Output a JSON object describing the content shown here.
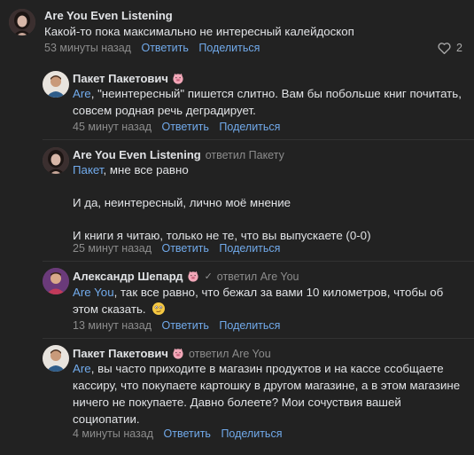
{
  "comments": [
    {
      "author": "Are You Even Listening",
      "text": "Какой-то пока максимально не интересный калейдоскоп",
      "time": "53 минуты назад",
      "reply_label": "Ответить",
      "share_label": "Поделиться",
      "likes": "2"
    },
    {
      "author": "Пакет Пакетович",
      "mention": "Are",
      "text": ", \"неинтересный\" пишется слитно. Вам бы побольше книг почитать, совсем родная речь деградирует.",
      "time": "45 минут назад",
      "reply_label": "Ответить",
      "share_label": "Поделиться"
    },
    {
      "author": "Are You Even Listening",
      "replied_to": "ответил Пакету",
      "mention": "Пакет",
      "text_line1": ", мне все равно",
      "text_line2": "И да, неинтересный, лично моё мнение",
      "text_line3": "И книги я читаю, только не те, что вы выпускаете (0-0)",
      "time": "25 минут назад",
      "reply_label": "Ответить",
      "share_label": "Поделиться"
    },
    {
      "author": "Александр Шепард",
      "replied_to": "ответил Are You",
      "mention": "Are You",
      "text": ", так все равно, что бежал за вами 10 километров, чтобы об этом сказать.",
      "time": "13 минут назад",
      "reply_label": "Ответить",
      "share_label": "Поделиться"
    },
    {
      "author": "Пакет Пакетович",
      "replied_to": "ответил Are You",
      "mention": "Are",
      "text": ", вы часто приходите в магазин продуктов и на кассе ссобщаете кассиру, что покупаете картошку в другом магазине, а в этом магазине ничего не покупаете. Давно болеете? Мои сочуствия вашей социопатии.",
      "time": "4 минуты назад",
      "reply_label": "Ответить",
      "share_label": "Поделиться"
    }
  ]
}
